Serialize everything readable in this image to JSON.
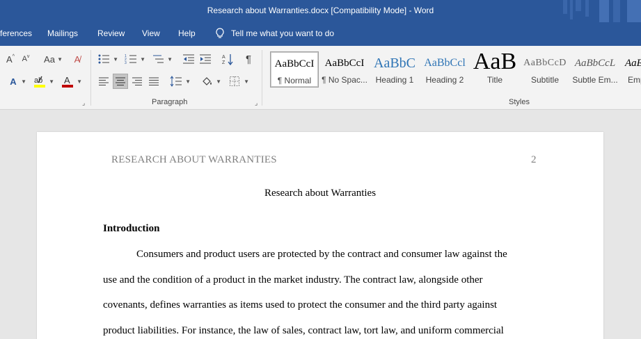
{
  "window": {
    "title": "Research about Warranties.docx [Compatibility Mode]  -  Word"
  },
  "menu": {
    "tabs": [
      "ferences",
      "Mailings",
      "Review",
      "View",
      "Help"
    ],
    "tell_me": "Tell me what you want to do"
  },
  "ribbon": {
    "groups": {
      "paragraph": "Paragraph",
      "styles": "Styles"
    },
    "font_buttons": {
      "grow": "A",
      "shrink": "A",
      "change_case": "Aa"
    },
    "styles": [
      {
        "sample": "AaBbCcI",
        "name": "¶ Normal"
      },
      {
        "sample": "AaBbCcI",
        "name": "¶ No Spac..."
      },
      {
        "sample": "AaBbC",
        "name": "Heading 1"
      },
      {
        "sample": "AaBbCcl",
        "name": "Heading 2"
      },
      {
        "sample": "AaB",
        "name": "Title"
      },
      {
        "sample": "AaBbCcD",
        "name": "Subtitle"
      },
      {
        "sample": "AaBbCcL",
        "name": "Subtle Em..."
      },
      {
        "sample": "AaE",
        "name": "Emp"
      }
    ],
    "colors": {
      "highlight": "#ffff00",
      "font_color": "#c00000",
      "accent": "#2b579a"
    }
  },
  "document": {
    "header_text": "RESEARCH ABOUT WARRANTIES",
    "page_number": "2",
    "title": "Research about Warranties",
    "section_heading": "Introduction",
    "lines": [
      "Consumers and product users are protected by the contract and consumer law against the",
      "use and the condition of a product in the market industry. The contract law, alongside other",
      "covenants, defines warranties as items used to protect the consumer and the third party against",
      "product liabilities. For instance, the law of sales, contract law, tort law, and uniform commercial"
    ]
  }
}
